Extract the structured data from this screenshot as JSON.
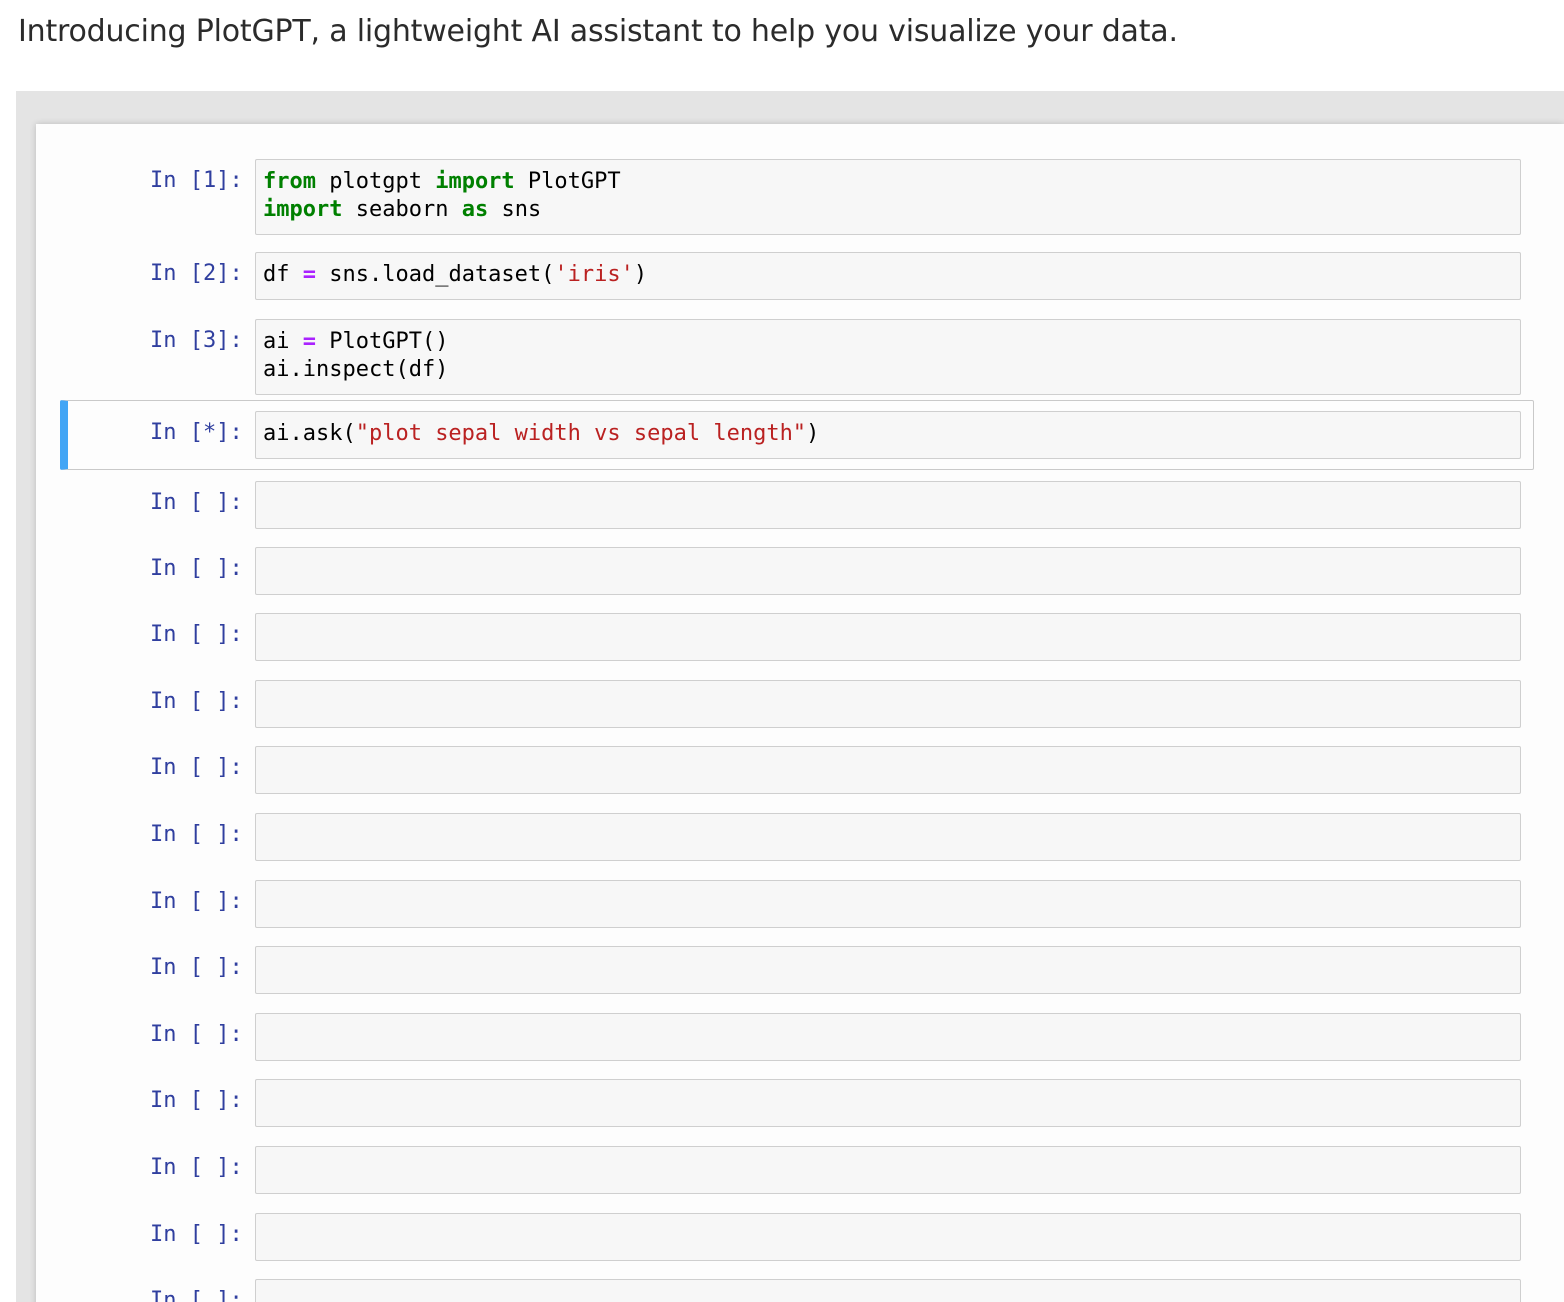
{
  "intro": {
    "text": "Introducing PlotGPT, a lightweight AI assistant to help you visualize your data."
  },
  "cells": [
    {
      "prompt": "In [1]:",
      "lines": [
        [
          {
            "t": "from",
            "c": "kw"
          },
          {
            "t": " plotgpt ",
            "c": ""
          },
          {
            "t": "import",
            "c": "kw"
          },
          {
            "t": " PlotGPT",
            "c": ""
          }
        ],
        [
          {
            "t": "import",
            "c": "kw"
          },
          {
            "t": " seaborn ",
            "c": ""
          },
          {
            "t": "as",
            "c": "kw"
          },
          {
            "t": " sns",
            "c": ""
          }
        ]
      ]
    },
    {
      "prompt": "In [2]:",
      "lines": [
        [
          {
            "t": "df ",
            "c": ""
          },
          {
            "t": "=",
            "c": "op"
          },
          {
            "t": " sns.load_dataset(",
            "c": ""
          },
          {
            "t": "'iris'",
            "c": "str"
          },
          {
            "t": ")",
            "c": ""
          }
        ]
      ]
    },
    {
      "prompt": "In [3]:",
      "lines": [
        [
          {
            "t": "ai ",
            "c": ""
          },
          {
            "t": "=",
            "c": "op"
          },
          {
            "t": " PlotGPT()",
            "c": ""
          }
        ],
        [
          {
            "t": "ai.inspect(df)",
            "c": ""
          }
        ]
      ]
    },
    {
      "prompt": "In [*]:",
      "selected": true,
      "lines": [
        [
          {
            "t": "ai.ask(",
            "c": ""
          },
          {
            "t": "\"plot sepal width vs sepal length\"",
            "c": "str"
          },
          {
            "t": ")",
            "c": ""
          }
        ]
      ]
    },
    {
      "prompt": "In [ ]:",
      "lines": []
    },
    {
      "prompt": "In [ ]:",
      "lines": []
    },
    {
      "prompt": "In [ ]:",
      "lines": []
    },
    {
      "prompt": "In [ ]:",
      "lines": []
    },
    {
      "prompt": "In [ ]:",
      "lines": []
    },
    {
      "prompt": "In [ ]:",
      "lines": []
    },
    {
      "prompt": "In [ ]:",
      "lines": []
    },
    {
      "prompt": "In [ ]:",
      "lines": []
    },
    {
      "prompt": "In [ ]:",
      "lines": []
    },
    {
      "prompt": "In [ ]:",
      "lines": []
    },
    {
      "prompt": "In [ ]:",
      "lines": []
    },
    {
      "prompt": "In [ ]:",
      "lines": []
    },
    {
      "prompt": "In [ ]:",
      "lines": []
    }
  ]
}
